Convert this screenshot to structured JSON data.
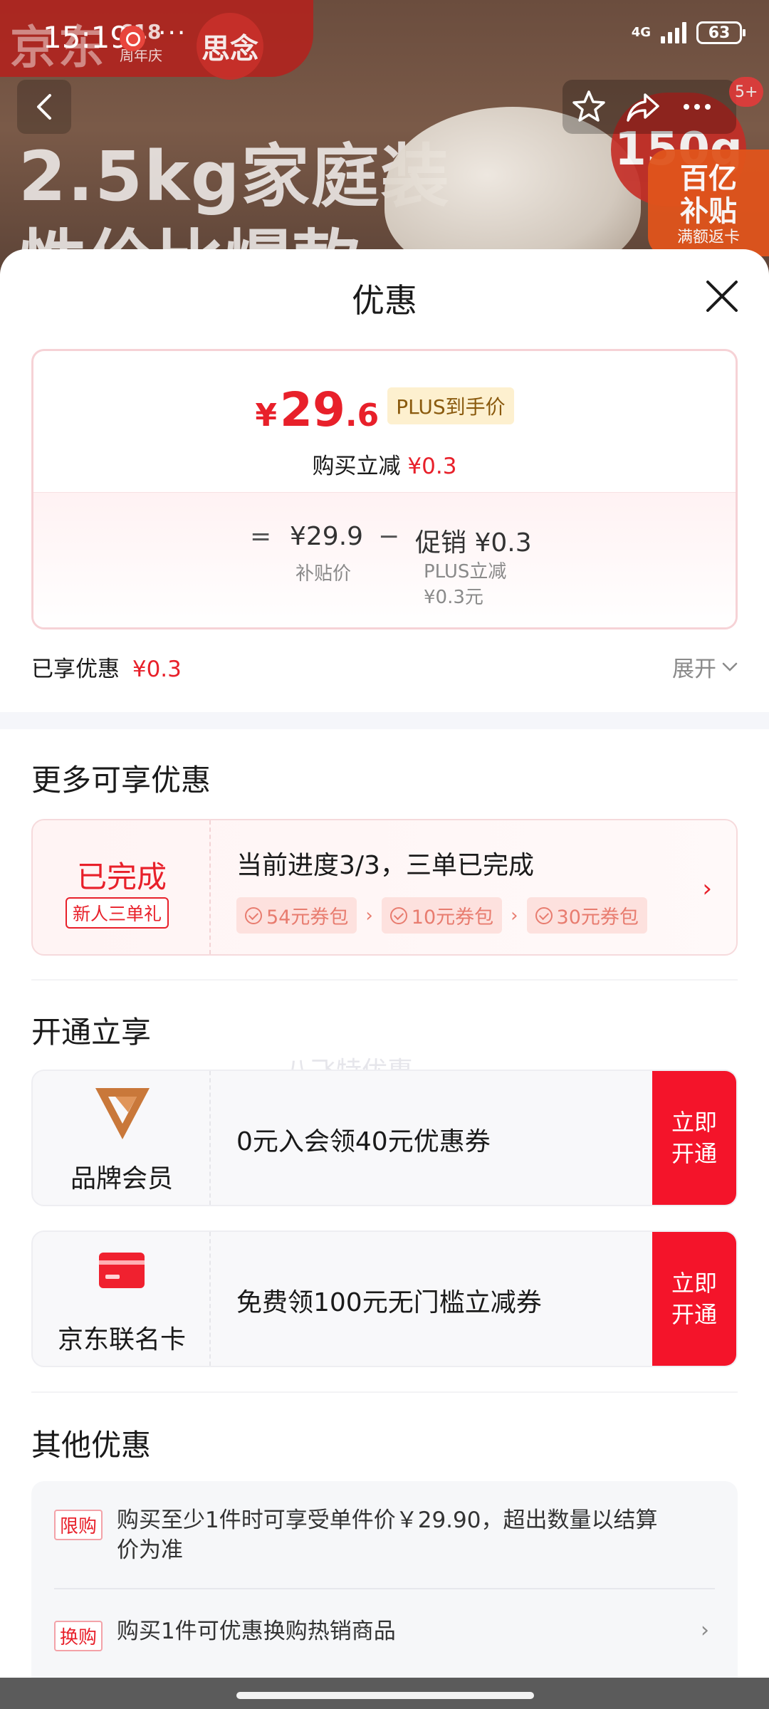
{
  "status_bar": {
    "time": "15:19",
    "more_dots": "···",
    "network": "4G",
    "battery": "63"
  },
  "background": {
    "brand_text": "京东",
    "promo_618": "618",
    "promo_anniv": "周年庆",
    "brand_badge": "思念",
    "headline_1": "2.5kg家庭装",
    "headline_2": "性价比爆款",
    "weight_badge": "150g",
    "subsidy_line1": "百亿",
    "subsidy_line2": "补贴",
    "subsidy_line3": "满额返卡",
    "cart_count": "5+"
  },
  "sheet": {
    "title": "优惠",
    "price_card": {
      "yen": "¥",
      "final_int": "29",
      "final_dec": ".6",
      "plus_tag": "PLUS到手价",
      "instant_label": "购买立减",
      "instant_value": "¥0.3",
      "eq": "=",
      "subsidy_value": "¥29.9",
      "minus": "−",
      "promo_text": "促销 ¥0.3",
      "subsidy_label": "补贴价",
      "promo_label_1": "PLUS立减",
      "promo_label_2": "¥0.3元"
    },
    "enjoyed_label": "已享优惠",
    "enjoyed_value": "¥0.3",
    "expand_label": "展开"
  },
  "more_offers": {
    "title": "更多可享优惠",
    "watermark": "八飞特优惠",
    "newbie": {
      "status": "已完成",
      "tag": "新人三单礼",
      "progress": "当前进度3/3，三单已完成",
      "chips": [
        "54元券包",
        "10元券包",
        "30元券包"
      ]
    }
  },
  "open_section": {
    "title": "开通立享",
    "cards": [
      {
        "label": "品牌会员",
        "text": "0元入会领40元优惠券",
        "btn_1": "立即",
        "btn_2": "开通"
      },
      {
        "label": "京东联名卡",
        "text": "免费领100元无门槛立减券",
        "btn_1": "立即",
        "btn_2": "开通"
      }
    ]
  },
  "other_section": {
    "title": "其他优惠",
    "items": [
      {
        "tag": "限购",
        "text": "购买至少1件时可享受单件价￥29.90，超出数量以结算价为准"
      },
      {
        "tag": "换购",
        "text": "购买1件可优惠换购热销商品"
      }
    ]
  },
  "colors": {
    "accent_red": "#e8202a",
    "button_red": "#f4142a",
    "plus_gold_bg": "#fdf0cf"
  }
}
